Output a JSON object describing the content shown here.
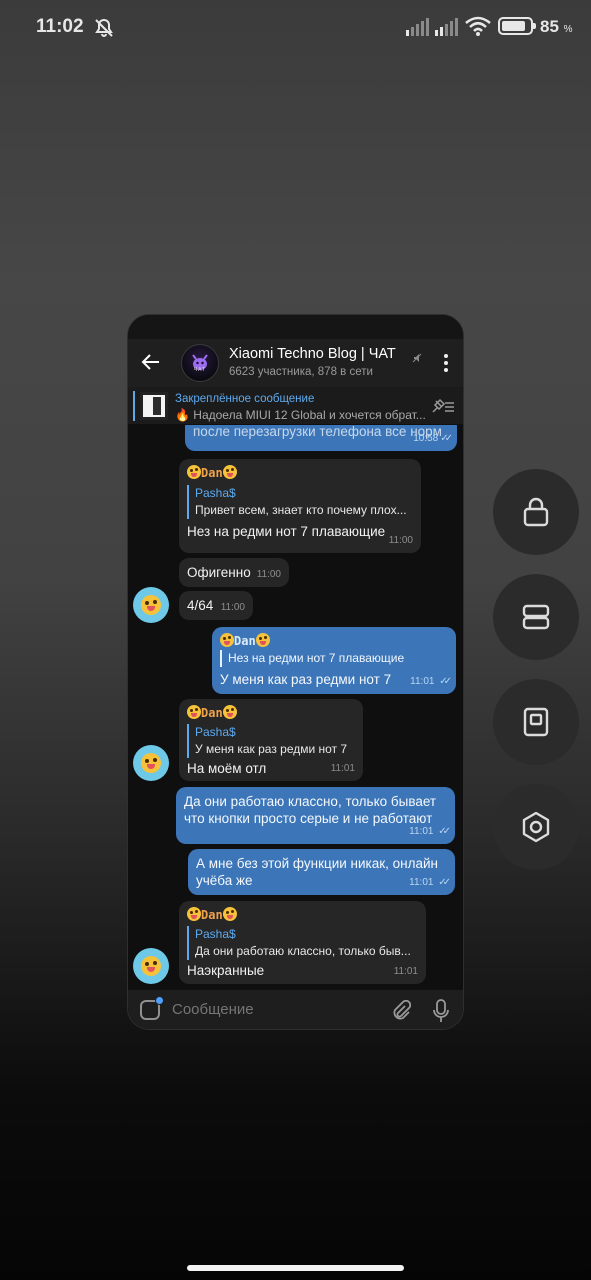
{
  "status_bar": {
    "time": "11:02",
    "battery_percent": "85",
    "battery_unit": "%",
    "battery_level": 0.85
  },
  "chat": {
    "title": "Xiaomi Techno Blog | ЧАТ",
    "subtitle": "6623 участника, 878 в сети",
    "avatar_label": "ЧАТ",
    "pinned": {
      "title": "Закреплённое сообщение",
      "text": "🔥 Надоела MIUI 12 Global и хочется обрат..."
    },
    "messages": [
      {
        "type": "out",
        "text": "после перезагрузки телефона все норм",
        "time": "10:58"
      },
      {
        "type": "in",
        "sender": "Dan",
        "reply_name": "Pasha$",
        "reply_text": "Привет всем, знает кто почему плох...",
        "text": "Нез на редми нот 7 плавающие",
        "time": "11:00"
      },
      {
        "type": "in",
        "text": "Офигенно",
        "time": "11:00"
      },
      {
        "type": "in",
        "text": "4/64",
        "time": "11:00"
      },
      {
        "type": "out",
        "sender": "Dan",
        "reply_text": "Нез на редми нот 7 плавающие",
        "text": "У меня как раз редми нот 7",
        "time": "11:01"
      },
      {
        "type": "in",
        "sender": "Dan",
        "reply_name": "Pasha$",
        "reply_text": "У меня как раз редми нот 7",
        "text": "На моём отл",
        "time": "11:01"
      },
      {
        "type": "out",
        "text_line1": "Да они работаю классно, только бывает",
        "text_line2": "что кнопки просто серые и не работают",
        "time": "11:01"
      },
      {
        "type": "out",
        "text_line1": "А мне без этой функции никак, онлайн",
        "text_line2": "учёба же",
        "time": "11:01"
      },
      {
        "type": "in",
        "sender": "Dan",
        "reply_name": "Pasha$",
        "reply_text": "Да они работаю классно, только быв...",
        "text": "Наэкранные",
        "time": "11:01"
      }
    ],
    "input_placeholder": "Сообщение"
  },
  "icons": {
    "back": "arrow-left-icon",
    "menu": "more-vertical-icon",
    "unpin": "unpin-list-icon",
    "attach": "paperclip-icon",
    "mic": "microphone-icon",
    "side": [
      "lock-icon",
      "split-screen-icon",
      "small-window-icon",
      "settings-hexagon-icon"
    ]
  },
  "colors": {
    "outgoing_bubble": "#3c76b8",
    "incoming_bubble": "#262626",
    "accent": "#5eaaf0",
    "sender_name": "#f0a24a"
  }
}
